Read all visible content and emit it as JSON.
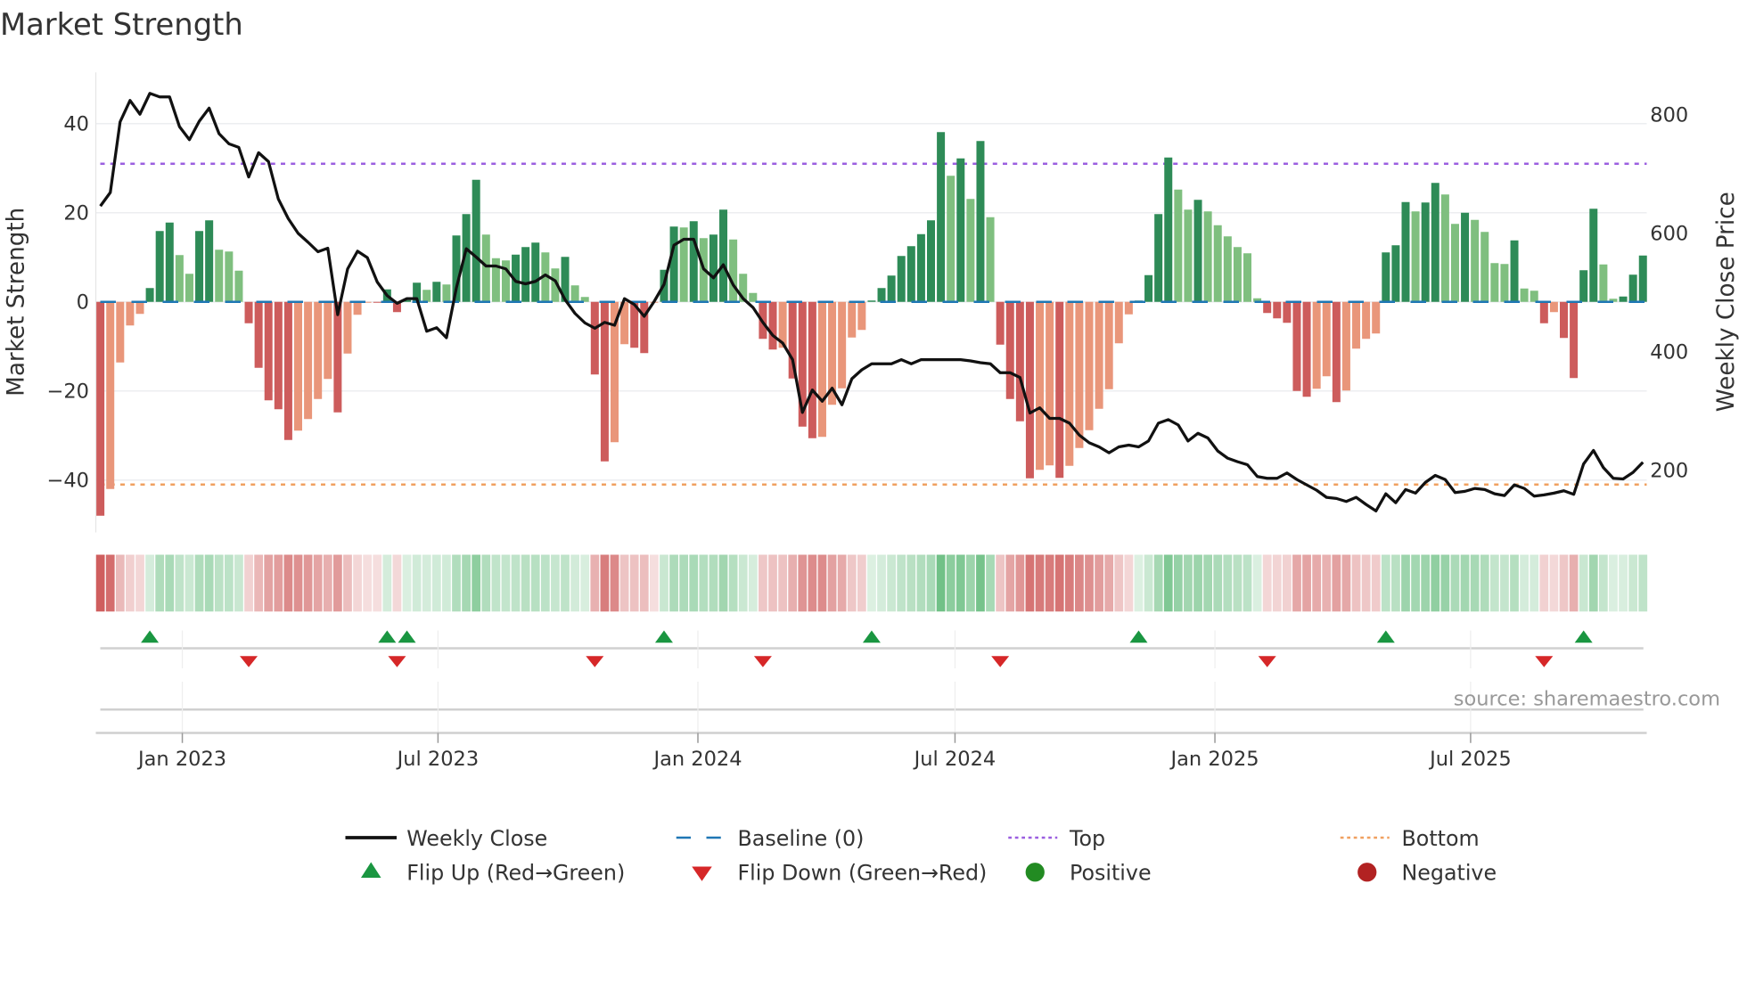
{
  "chart_data": {
    "type": "bar",
    "title": "Market Strength",
    "ylabel": "Market Strength",
    "y2label": "Weekly Close Price",
    "source": "source: sharemaestro.com",
    "frequency": "weekly",
    "start_date": "2022-11-04",
    "ylim": [
      -52,
      52
    ],
    "y2lim": [
      111,
      886
    ],
    "yticks": [
      40,
      20,
      0,
      -20,
      -40
    ],
    "ytick_labels": [
      "40",
      "20",
      "0",
      "−20",
      "−40"
    ],
    "y2ticks": [
      800,
      600,
      400,
      200
    ],
    "y2tick_labels": [
      "800",
      "600",
      "400",
      "200"
    ],
    "xticks": [
      {
        "date": "2023-01-01",
        "label": "Jan 2023"
      },
      {
        "date": "2023-07-01",
        "label": "Jul 2023"
      },
      {
        "date": "2024-01-01",
        "label": "Jan 2024"
      },
      {
        "date": "2024-07-01",
        "label": "Jul 2024"
      },
      {
        "date": "2025-01-01",
        "label": "Jan 2025"
      },
      {
        "date": "2025-07-01",
        "label": "Jul 2025"
      }
    ],
    "top_level": 31,
    "bottom_level": -41,
    "baseline": 0,
    "grid": true,
    "legend_position": "bottom-center",
    "legend": {
      "weekly_close": "Weekly Close",
      "baseline": "Baseline (0)",
      "top": "Top",
      "bottom": "Bottom",
      "flip_up": "Flip Up (Red→Green)",
      "flip_down": "Flip Down (Green→Red)",
      "positive": "Positive",
      "negative": "Negative"
    },
    "colors": {
      "pos_strong": "#2e8b57",
      "pos_weak": "#7fbf7f",
      "neg_strong": "#cd5c5c",
      "neg_weak": "#e9967a",
      "baseline": "#1f77b4",
      "top": "#9b5fe0",
      "bottom": "#f0a060",
      "close": "#111111",
      "flip_up": "#1a9641",
      "flip_down": "#d62728",
      "positive_dot": "#228b22",
      "negative_dot": "#b22222"
    },
    "strength": [
      -48,
      -42,
      -13.6,
      -5.3,
      -2.7,
      3.1,
      15.9,
      17.8,
      10.5,
      6.3,
      15.9,
      18.3,
      11.7,
      11.3,
      7,
      -4.8,
      -14.8,
      -22.1,
      -24.1,
      -31,
      -28.9,
      -26.3,
      -21.8,
      -17.3,
      -24.8,
      -11.6,
      -2.9,
      -0.2,
      -0.2,
      2.8,
      -2.3,
      0.4,
      4.3,
      2.7,
      4.5,
      3.9,
      14.9,
      19.7,
      27.4,
      15.1,
      9.8,
      9.3,
      10.6,
      12.3,
      13.3,
      11.1,
      7.5,
      10.1,
      3.7,
      1.1,
      -16.3,
      -35.8,
      -31.5,
      -9.5,
      -10.3,
      -11.5,
      -0.2,
      7.2,
      16.9,
      16.7,
      18.1,
      14.3,
      15.1,
      20.7,
      14,
      6.3,
      2,
      -8.3,
      -10.7,
      -10.3,
      -17.2,
      -28,
      -30.6,
      -30.3,
      -23.1,
      -19.4,
      -8,
      -6.3,
      0.3,
      3.1,
      5.9,
      10.3,
      12.5,
      15.2,
      18.3,
      38.1,
      28.3,
      32.2,
      23.1,
      36.1,
      19,
      -9.6,
      -21.8,
      -26.8,
      -39.6,
      -37.7,
      -36.7,
      -39.5,
      -36.8,
      -32.8,
      -28.8,
      -24,
      -19.6,
      -9.3,
      -2.8,
      0.3,
      6,
      19.7,
      32.4,
      25.2,
      20.7,
      22.9,
      20.3,
      17.2,
      14.7,
      12.3,
      10.9,
      0.8,
      -2.5,
      -3.7,
      -4.7,
      -20,
      -21.3,
      -19.5,
      -16.7,
      -22.5,
      -19.9,
      -10.5,
      -8.3,
      -7.1,
      11.1,
      12.7,
      22.4,
      20.3,
      22.3,
      26.7,
      24.1,
      17.5,
      20,
      18.4,
      15.7,
      8.7,
      8.5,
      13.8,
      3,
      2.5,
      -4.8,
      -2.3,
      -8.1,
      -17.1,
      7.1,
      20.9,
      8.4,
      0.7,
      1.2,
      6.1,
      10.4
    ],
    "weekly_close": [
      646,
      669,
      788,
      824,
      801,
      836,
      830,
      830,
      780,
      758,
      789,
      811,
      768,
      751,
      745,
      695,
      736,
      721,
      658,
      625,
      600,
      585,
      569,
      575,
      463,
      540,
      570,
      559,
      518,
      495,
      482,
      490,
      490,
      435,
      441,
      424,
      508,
      574,
      560,
      545,
      545,
      540,
      519,
      515,
      519,
      530,
      520,
      488,
      465,
      449,
      440,
      450,
      445,
      490,
      480,
      460,
      485,
      514,
      580,
      590,
      590,
      540,
      525,
      547,
      513,
      490,
      475,
      450,
      428,
      415,
      387,
      298,
      336,
      317,
      339,
      311,
      355,
      370,
      380,
      380,
      380,
      387,
      380,
      387,
      387,
      387,
      387,
      387,
      385,
      382,
      380,
      365,
      365,
      357,
      297,
      306,
      288,
      288,
      280,
      260,
      247,
      240,
      230,
      240,
      243,
      240,
      250,
      280,
      286,
      277,
      250,
      263,
      255,
      233,
      221,
      215,
      210,
      190,
      187,
      187,
      196,
      185,
      176,
      167,
      155,
      153,
      148,
      155,
      143,
      132,
      161,
      146,
      168,
      162,
      180,
      192,
      185,
      163,
      165,
      170,
      168,
      161,
      158,
      176,
      170,
      157,
      159,
      162,
      166,
      160,
      211,
      234,
      205,
      187,
      186,
      197,
      214
    ]
  }
}
